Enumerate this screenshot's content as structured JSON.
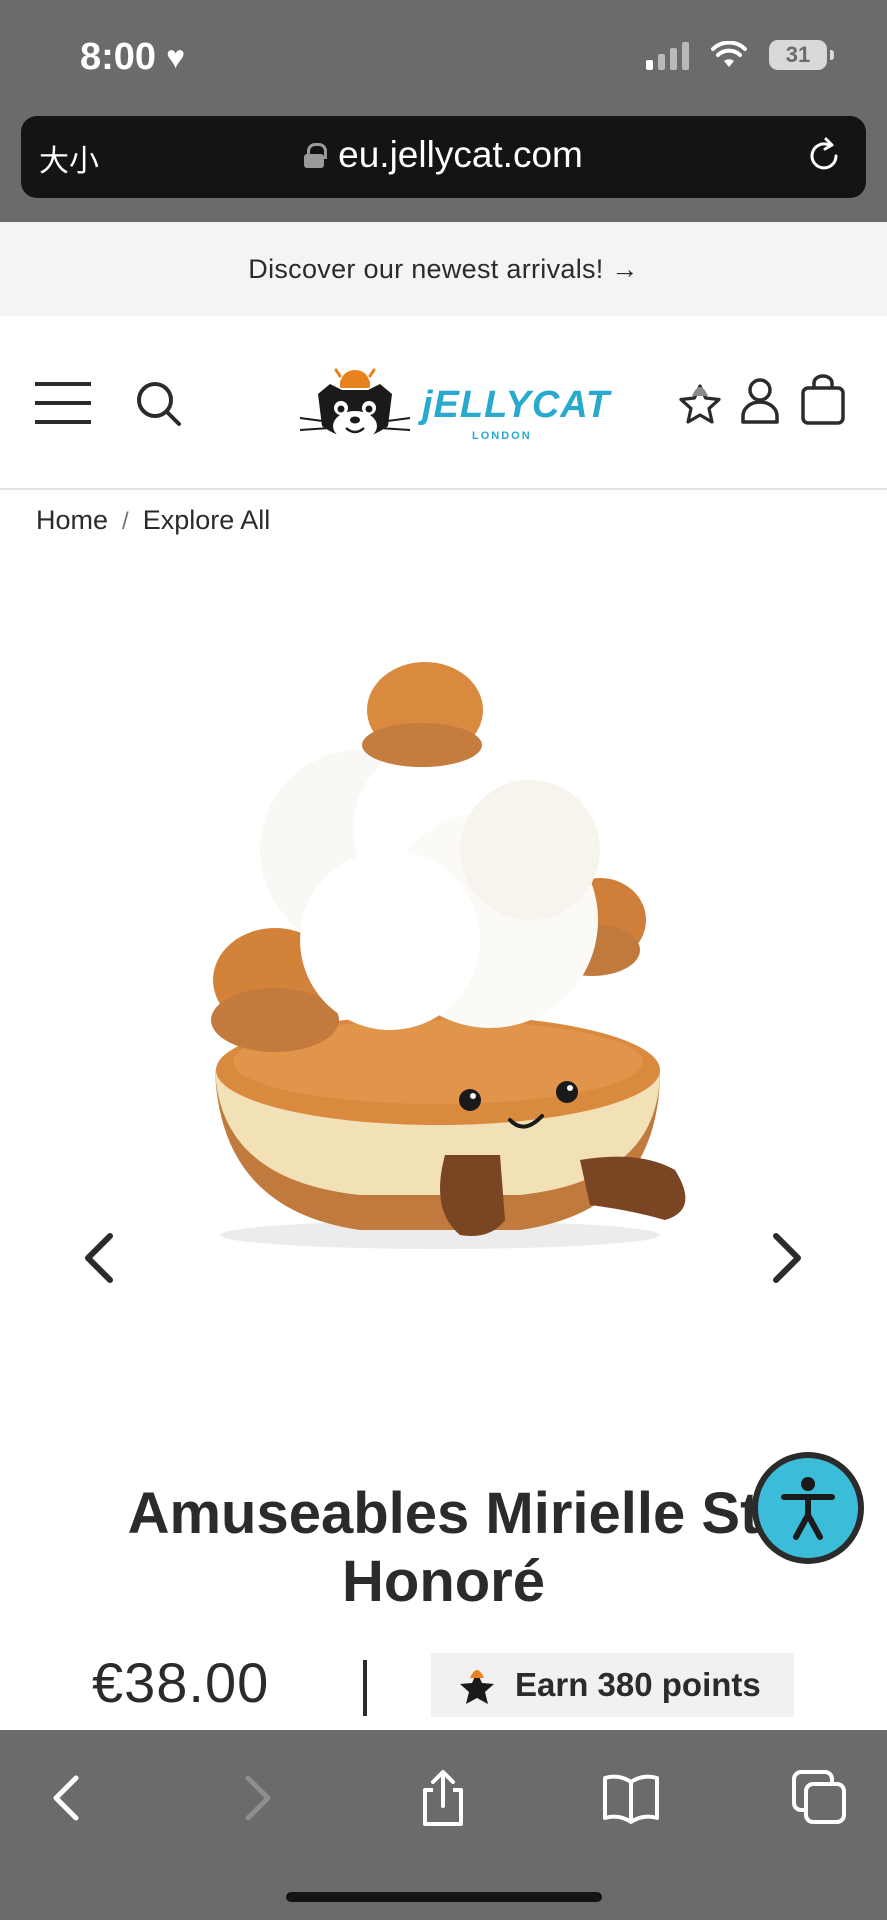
{
  "status_bar": {
    "time": "8:00",
    "battery": "31"
  },
  "browser": {
    "text_size_label": "大小",
    "url": "eu.jellycat.com"
  },
  "promo": {
    "text": "Discover our newest arrivals! →"
  },
  "header": {
    "logo_text": "jELLYCAT",
    "logo_subtext": "LONDON"
  },
  "breadcrumb": {
    "items": [
      "Home",
      "Explore All"
    ],
    "separator": "/"
  },
  "product": {
    "title_line1": "Amuseables Mirielle St",
    "title_line2": "Honoré",
    "price": "€38.00",
    "points": "Earn 380 points",
    "image_alt": "Amuseables Mirielle St Honoré plush"
  },
  "colors": {
    "accent_teal": "#3bbcd8",
    "brand_orange": "#e8821e",
    "chrome_gray": "#6b6b6b"
  },
  "icons": {
    "menu": "hamburger-icon",
    "search": "search-icon",
    "wishlist": "star-icon",
    "account": "user-icon",
    "bag": "shopping-bag-icon",
    "prev": "chevron-left-icon",
    "next": "chevron-right-icon",
    "accessibility": "accessibility-icon"
  }
}
